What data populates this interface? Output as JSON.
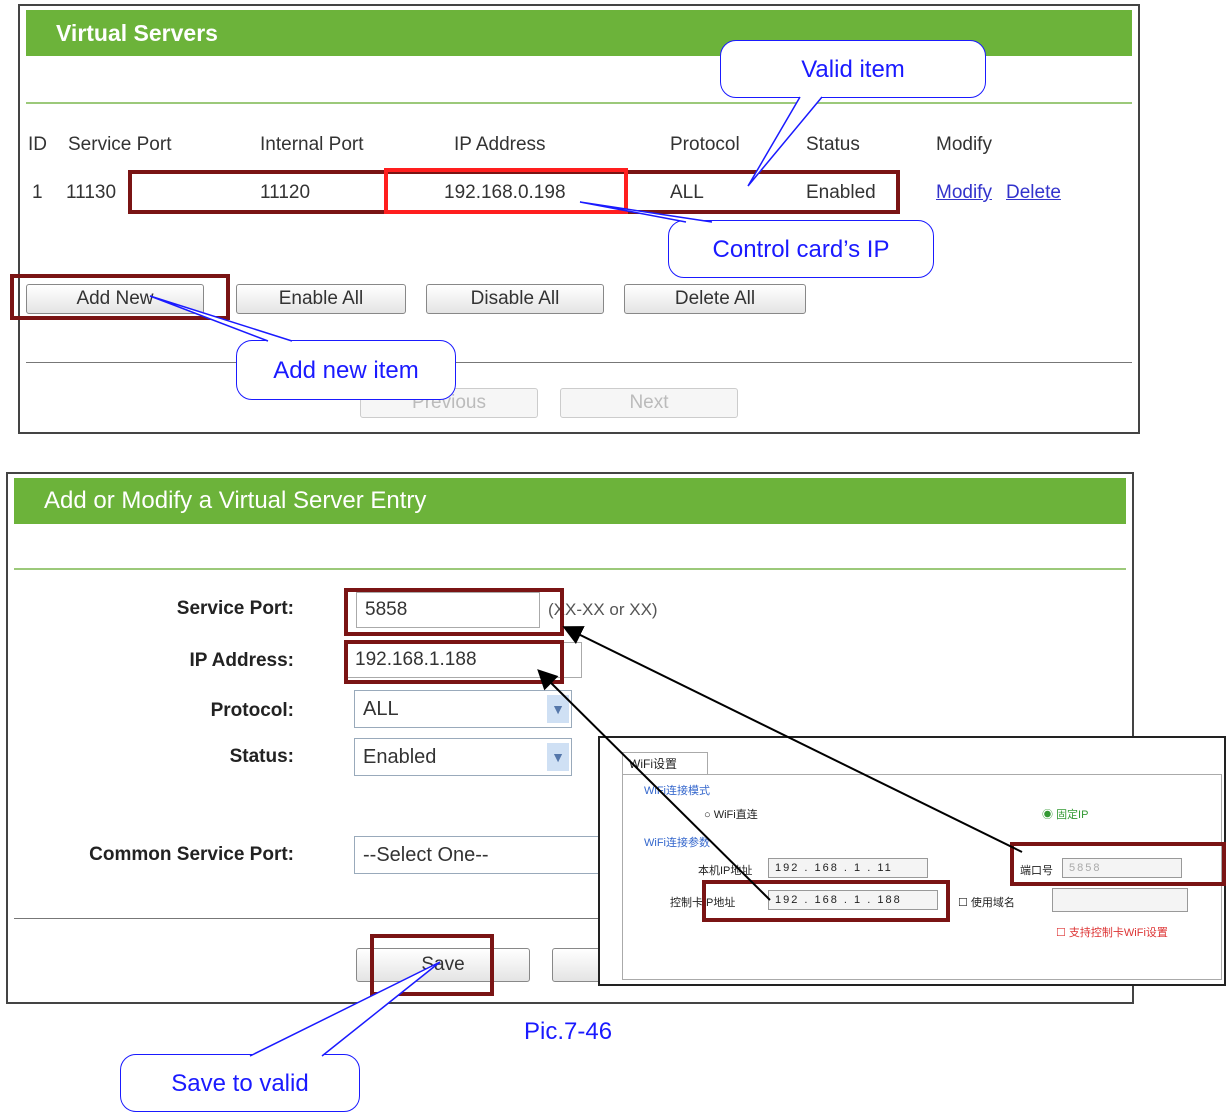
{
  "top_panel": {
    "title": "Virtual Servers",
    "columns": [
      "ID",
      "Service Port",
      "Internal Port",
      "IP Address",
      "Protocol",
      "Status",
      "Modify"
    ],
    "row": {
      "id": "1",
      "service_port": "11130",
      "internal_port": "11120",
      "ip": "192.168.0.198",
      "protocol": "ALL",
      "status": "Enabled",
      "modify": "Modify",
      "delete": "Delete"
    },
    "buttons": {
      "add_new": "Add New",
      "enable_all": "Enable All",
      "disable_all": "Disable All",
      "delete_all": "Delete All",
      "previous": "Previous",
      "next": "Next"
    }
  },
  "bottom_panel": {
    "title": "Add or Modify a Virtual Server Entry",
    "service_port_label": "Service Port:",
    "service_port_value": "5858",
    "service_port_hint": "(XX-XX or XX)",
    "ip_label": "IP Address:",
    "ip_value": "192.168.1.188",
    "protocol_label": "Protocol:",
    "protocol_value": "ALL",
    "status_label": "Status:",
    "status_value": "Enabled",
    "common_port_label": "Common Service Port:",
    "common_port_value": "--Select One--",
    "save": "Save"
  },
  "inset": {
    "tab": "WiFi设置",
    "mode_group": "WiFi连接模式",
    "mode_direct": "WiFi直连",
    "mode_fixed": "固定IP",
    "param_group": "WiFi连接参数",
    "local_ip_label": "本机IP地址",
    "local_ip": "192 . 168 . 1 . 11",
    "port_label": "端口号",
    "port_value": "5858",
    "ctrl_ip_label": "控制卡IP地址",
    "ctrl_ip": "192 . 168 . 1 . 188",
    "use_domain": "使用域名",
    "support_wifi": "支持控制卡WiFi设置"
  },
  "callouts": {
    "valid_item": "Valid item",
    "control_card_ip": "Control card’s IP",
    "add_new_item": "Add new item",
    "save_to_valid": "Save to valid"
  },
  "caption": "Pic.7-46"
}
